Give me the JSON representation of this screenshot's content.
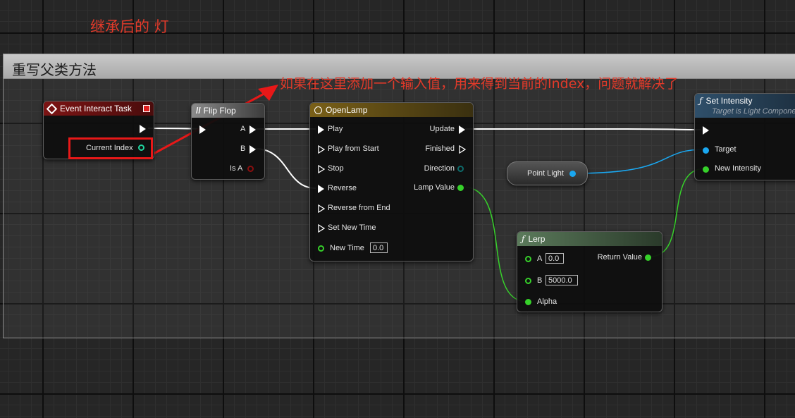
{
  "annotations": {
    "title": "继承后的 灯",
    "note": "如果在这里添加一个输入值，用来得到当前的Index，问题就解决了"
  },
  "comment_box": {
    "title": "重写父类方法"
  },
  "nodes": {
    "event_interact": {
      "title": "Event Interact Task",
      "pin_current_index": "Current Index"
    },
    "flip_flop": {
      "title": "Flip Flop",
      "pin_a": "A",
      "pin_b": "B",
      "pin_is_a": "Is A"
    },
    "open_lamp": {
      "title": "OpenLamp",
      "pins_in": [
        "Play",
        "Play from Start",
        "Stop",
        "Reverse",
        "Reverse from End",
        "Set New Time"
      ],
      "new_time_label": "New Time",
      "new_time_value": "0.0",
      "pins_out": [
        "Update",
        "Finished",
        "Direction",
        "Lamp Value"
      ]
    },
    "point_light": {
      "label": "Point Light"
    },
    "lerp": {
      "title": "Lerp",
      "pin_a": "A",
      "a_value": "0.0",
      "pin_b": "B",
      "b_value": "5000.0",
      "pin_alpha": "Alpha",
      "return_value": "Return Value"
    },
    "set_intensity": {
      "title": "Set Intensity",
      "subtitle": "Target is Light Component",
      "pin_target": "Target",
      "pin_new_intensity": "New Intensity"
    }
  },
  "colors": {
    "annotation_red": "#e23a2a",
    "float_pin_green": "#36d12a",
    "object_pin_blue": "#1aa7f0",
    "bool_pin_red": "#8a0f0f",
    "int_pin_teal": "#1fd6a0",
    "event_header": "#7c1414",
    "timeline_header": "#6a5317",
    "function_header_lerp": "#4b6b4b",
    "function_header_set": "#2f4f6a"
  }
}
